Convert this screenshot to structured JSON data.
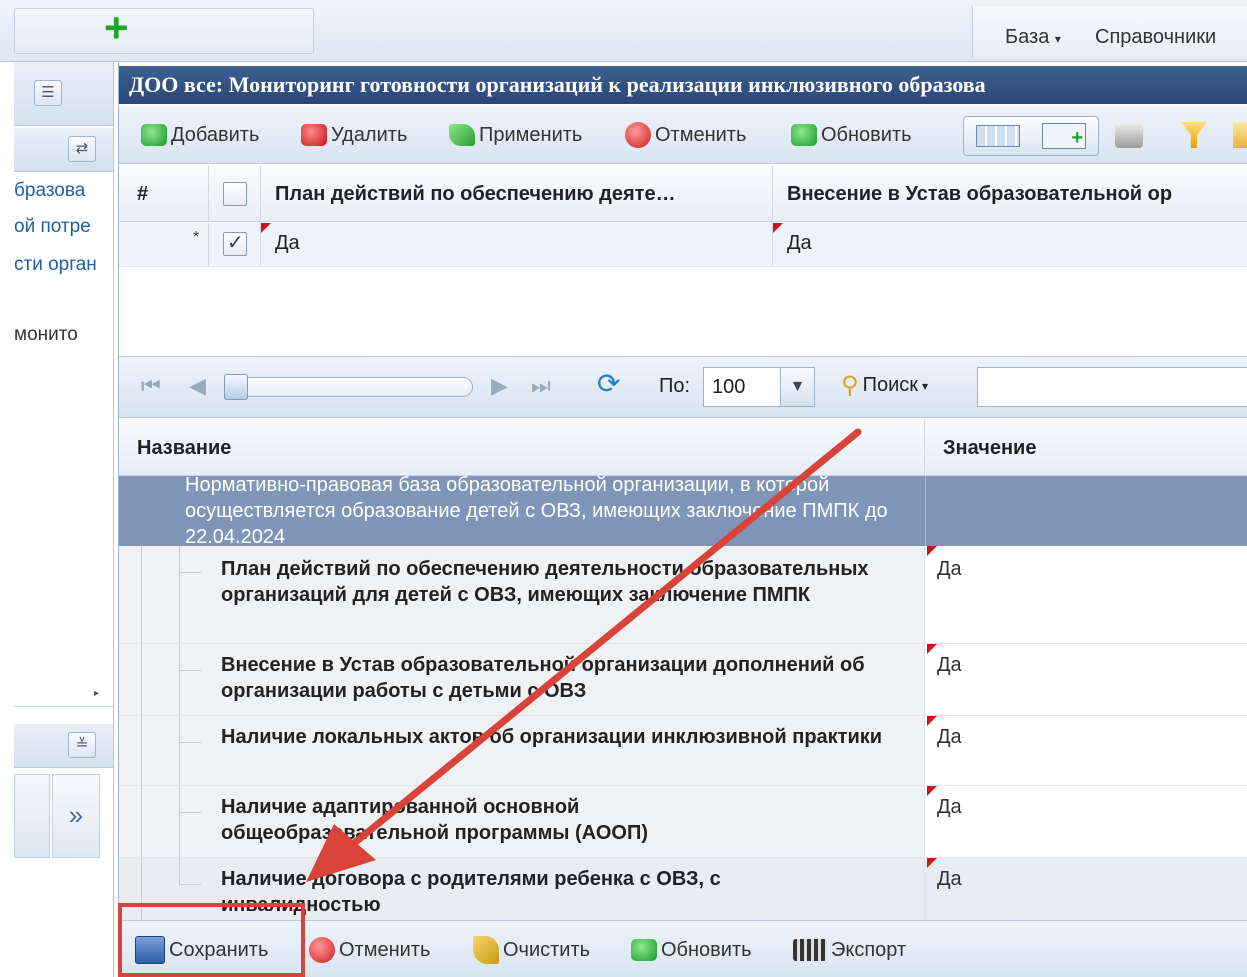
{
  "topbar": {
    "menu_base": "База",
    "menu_refs": "Справочники"
  },
  "sidebar": {
    "items": [
      "бразова",
      "ой потре",
      "сти орган",
      "монито"
    ],
    "expand_glyph": "»",
    "collapse_glyph": "≚"
  },
  "main": {
    "title": "ДОО все: Мониторинг готовности организаций к реализации инклюзивного образова"
  },
  "toolbar1": {
    "add": "Добавить",
    "delete": "Удалить",
    "apply": "Применить",
    "cancel": "Отменить",
    "refresh": "Обновить"
  },
  "grid1": {
    "headers": [
      "#",
      "План действий по обеспечению деяте…",
      "Внесение в Устав образовательной ор"
    ],
    "row": {
      "marker": "*",
      "checked": true,
      "values": [
        "Да",
        "Да"
      ]
    }
  },
  "pager": {
    "per_page_label": "По:",
    "per_page_value": "100",
    "search_label": "Поиск"
  },
  "grid2": {
    "headers": [
      "Название",
      "Значение"
    ],
    "group_row": "Нормативно-правовая база образовательной организации, в которой осуществляется образование детей с ОВЗ, имеющих заключение ПМПК до 22.04.2024",
    "rows": [
      {
        "name": "План действий по обеспечению деятельности образовательных организаций для детей с ОВЗ, имеющих заключение ПМПК",
        "value": "Да"
      },
      {
        "name": "Внесение в Устав образовательной организации дополнений об организации работы с детьми с ОВЗ",
        "value": "Да"
      },
      {
        "name": "Наличие локальных актов об организации инклюзивной практики",
        "value": "Да"
      },
      {
        "name": "Наличие адаптированной основной общеобразовательной программы (АООП)",
        "value": "Да"
      },
      {
        "name": "Наличие договора с родителями ребенка с ОВЗ, с инвалидностью",
        "value": "Да"
      }
    ]
  },
  "toolbar2": {
    "save": "Сохранить",
    "cancel": "Отменить",
    "clear": "Очистить",
    "refresh": "Обновить",
    "export": "Экспорт"
  },
  "colors": {
    "title_bar": "#2f4f80",
    "group_row": "#8096b8",
    "annotation_red": "#d9443a"
  }
}
